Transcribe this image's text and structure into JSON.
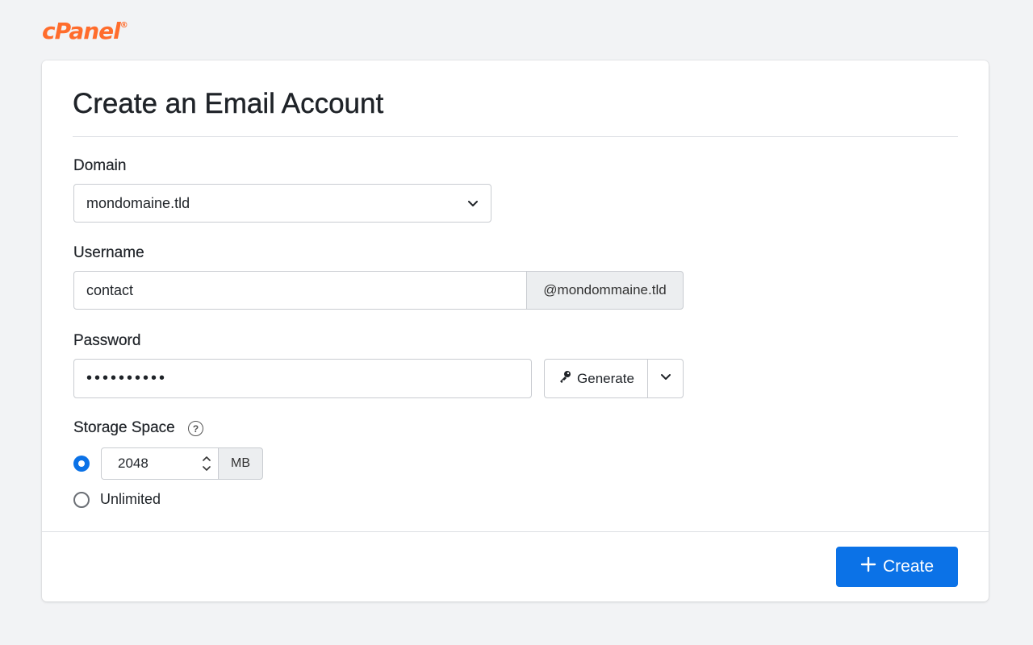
{
  "brand": {
    "logo_text": "cPanel",
    "logo_mark": "®",
    "color": "#ff6c2c"
  },
  "form": {
    "title": "Create an Email Account",
    "domain": {
      "label": "Domain",
      "value": "mondomaine.tld"
    },
    "username": {
      "label": "Username",
      "value": "contact",
      "suffix": "@mondommaine.tld"
    },
    "password": {
      "label": "Password",
      "value": "••••••••••",
      "generate_label": "Generate"
    },
    "storage": {
      "label": "Storage Space",
      "selected": "custom",
      "value": "2048",
      "unit": "MB",
      "unlimited_label": "Unlimited"
    },
    "create_label": "Create"
  },
  "colors": {
    "primary": "#0b72e7",
    "page_bg": "#f2f3f5"
  },
  "icons": [
    "chevron-down-icon",
    "key-icon",
    "help-circle-icon",
    "spinner-arrows-icon",
    "plus-icon"
  ]
}
